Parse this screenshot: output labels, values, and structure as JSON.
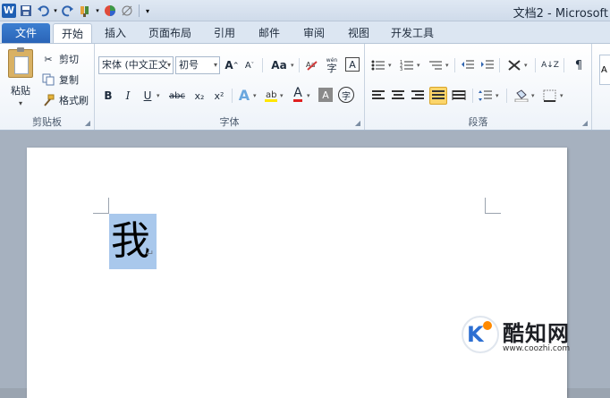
{
  "window": {
    "title": "文档2 - Microsoft"
  },
  "qat": {
    "logo": "W"
  },
  "tabs": {
    "file": "文件",
    "items": [
      "开始",
      "插入",
      "页面布局",
      "引用",
      "邮件",
      "审阅",
      "视图",
      "开发工具"
    ],
    "active": "开始"
  },
  "clipboard": {
    "paste": "粘贴",
    "cut": "剪切",
    "copy": "复制",
    "format_painter": "格式刷",
    "group_label": "剪贴板"
  },
  "font": {
    "font_name": "宋体 (中文正文",
    "font_size": "初号",
    "grow": "A",
    "shrink": "A",
    "change_case": "Aa",
    "bold": "B",
    "italic": "I",
    "underline": "U",
    "strikethrough": "abc",
    "subscript": "x₂",
    "superscript": "x²",
    "group_label": "字体",
    "text_effect": "A",
    "font_color": "A",
    "char_shading": "A",
    "enclose": "字",
    "phonetic": "wén",
    "border": "A"
  },
  "paragraph": {
    "group_label": "段落",
    "sort": "A↓Z"
  },
  "document": {
    "selected_text": "我",
    "paragraph_mark": "↵"
  },
  "watermark": {
    "brand": "酷知网",
    "url": "www.coozhi.com"
  },
  "colors": {
    "file_tab": "#2a64b7",
    "selection": "#a9c8ec",
    "active_align": "#fbd56b"
  }
}
